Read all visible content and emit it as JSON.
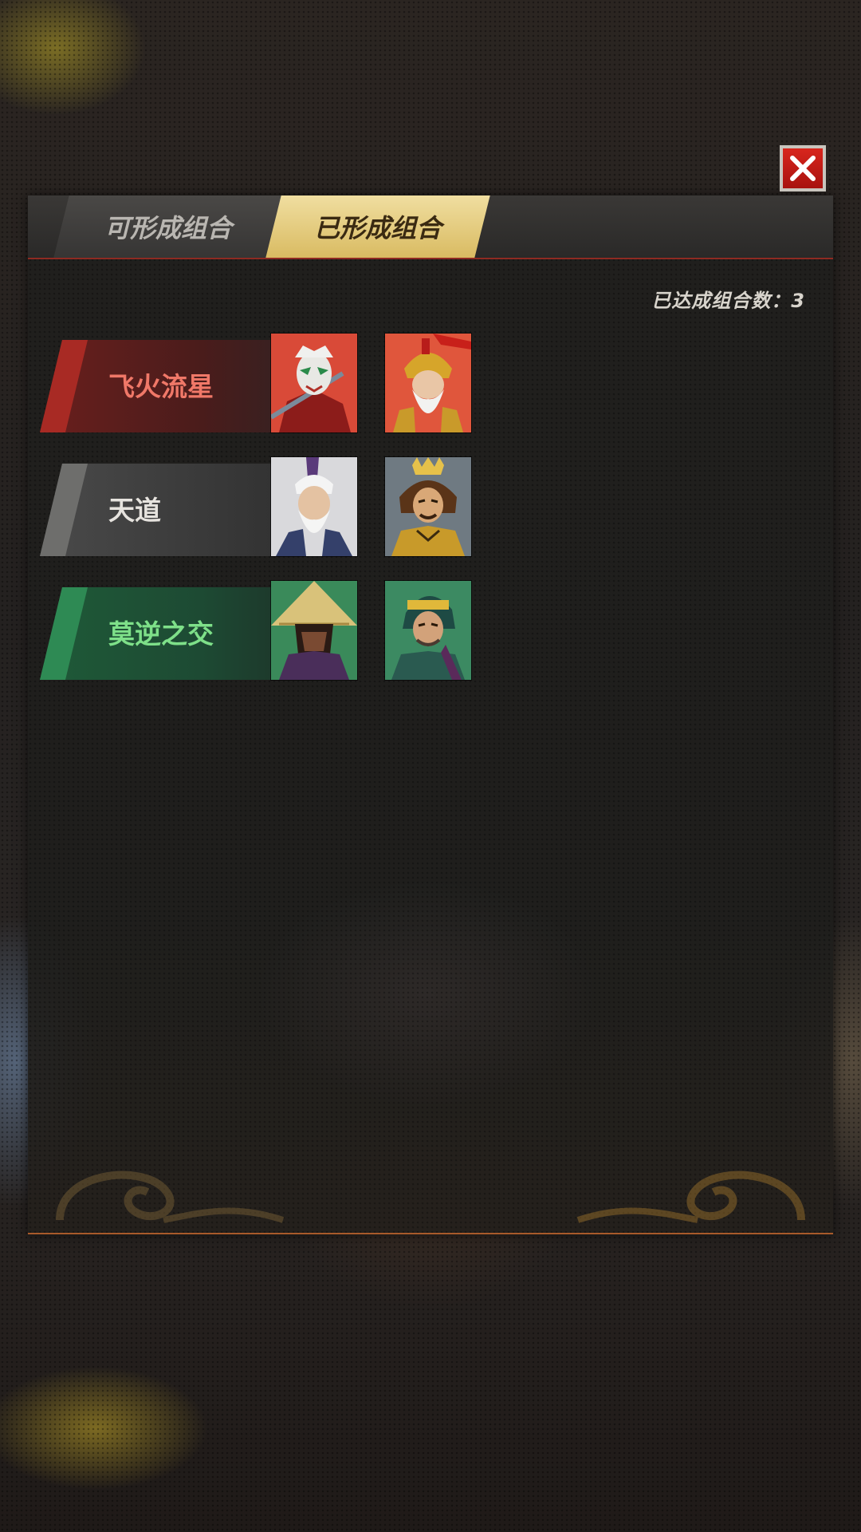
{
  "tabs": [
    {
      "label": "可形成组合",
      "active": false
    },
    {
      "label": "已形成组合",
      "active": true
    }
  ],
  "count": {
    "label": "已达成组合数：3"
  },
  "combos": [
    {
      "name": "飞火流星",
      "theme": "red",
      "name_color": "#f07868"
    },
    {
      "name": "天道",
      "theme": "gray",
      "name_color": "#e6e3de"
    },
    {
      "name": "莫逆之交",
      "theme": "green",
      "name_color": "#7ee089"
    }
  ],
  "colors": {
    "tab_active": "#e6cc7a",
    "close_button": "#c8191a",
    "panel_border": "#a85a2a"
  },
  "icons": {
    "close": "close-x-icon",
    "portraits": [
      "warrior-masked-portrait-icon",
      "old-general-gold-helmet-portrait-icon",
      "white-beard-sage-portrait-icon",
      "crowned-warlord-portrait-icon",
      "straw-hat-swordsman-portrait-icon",
      "headband-fighter-portrait-icon"
    ]
  }
}
